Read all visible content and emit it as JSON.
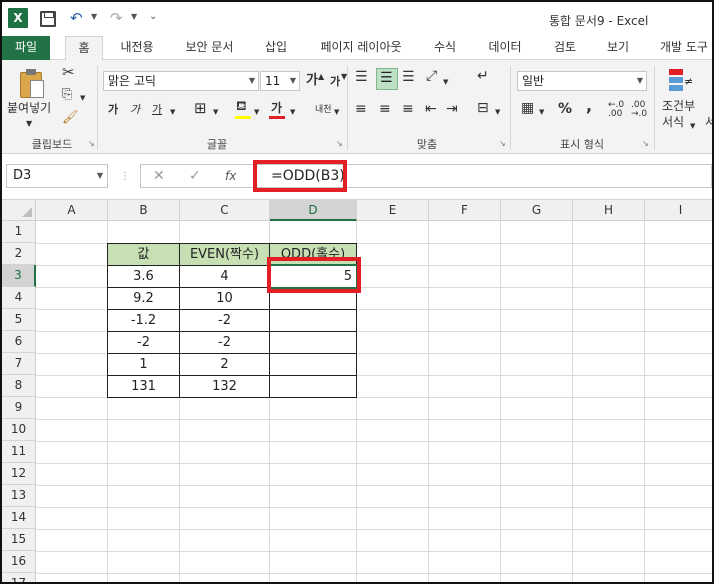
{
  "window": {
    "title": "통합 문서9 - Excel",
    "app_logo": "X"
  },
  "ribbon_tabs": [
    "파일",
    "홈",
    "내전용",
    "보안 문서",
    "삽입",
    "페이지 레이아웃",
    "수식",
    "데이터",
    "검토",
    "보기",
    "개발 도구"
  ],
  "ribbon": {
    "clipboard": {
      "paste_label": "붙여넣기",
      "group_label": "클립보드"
    },
    "font": {
      "font_name": "맑은 고딕",
      "font_size": "11",
      "group_label": "글꼴",
      "bold": "가",
      "italic": "가",
      "underline": "가",
      "grow": "가",
      "shrink": "가",
      "phonetic": "내천",
      "font_color_glyph": "가"
    },
    "alignment": {
      "group_label": "맞춤"
    },
    "number": {
      "format": "일반",
      "group_label": "표시 형식",
      "percent": "%",
      "comma": ","
    },
    "styles": {
      "conditional_label_1": "조건부",
      "conditional_label_2": "서식",
      "cut_label": "서"
    }
  },
  "formula_bar": {
    "name_box": "D3",
    "formula": "=ODD(B3)",
    "fx": "fx"
  },
  "columns": [
    "A",
    "B",
    "C",
    "D",
    "E",
    "F",
    "G",
    "H",
    "I"
  ],
  "rows": [
    "1",
    "2",
    "3",
    "4",
    "5",
    "6",
    "7",
    "8",
    "9",
    "10",
    "11",
    "12",
    "13",
    "14",
    "15",
    "16",
    "17"
  ],
  "table": {
    "headers": [
      "값",
      "EVEN(짝수)",
      "ODD(홀수)"
    ],
    "rows": [
      [
        "3.6",
        "4",
        "5"
      ],
      [
        "9.2",
        "10",
        ""
      ],
      [
        "-1.2",
        "-2",
        ""
      ],
      [
        "-2",
        "-2",
        ""
      ],
      [
        "1",
        "2",
        ""
      ],
      [
        "131",
        "132",
        ""
      ]
    ]
  },
  "colors": {
    "excel_green": "#217346",
    "header_fill": "#c6e0b4",
    "highlight_red": "#e31e24"
  }
}
